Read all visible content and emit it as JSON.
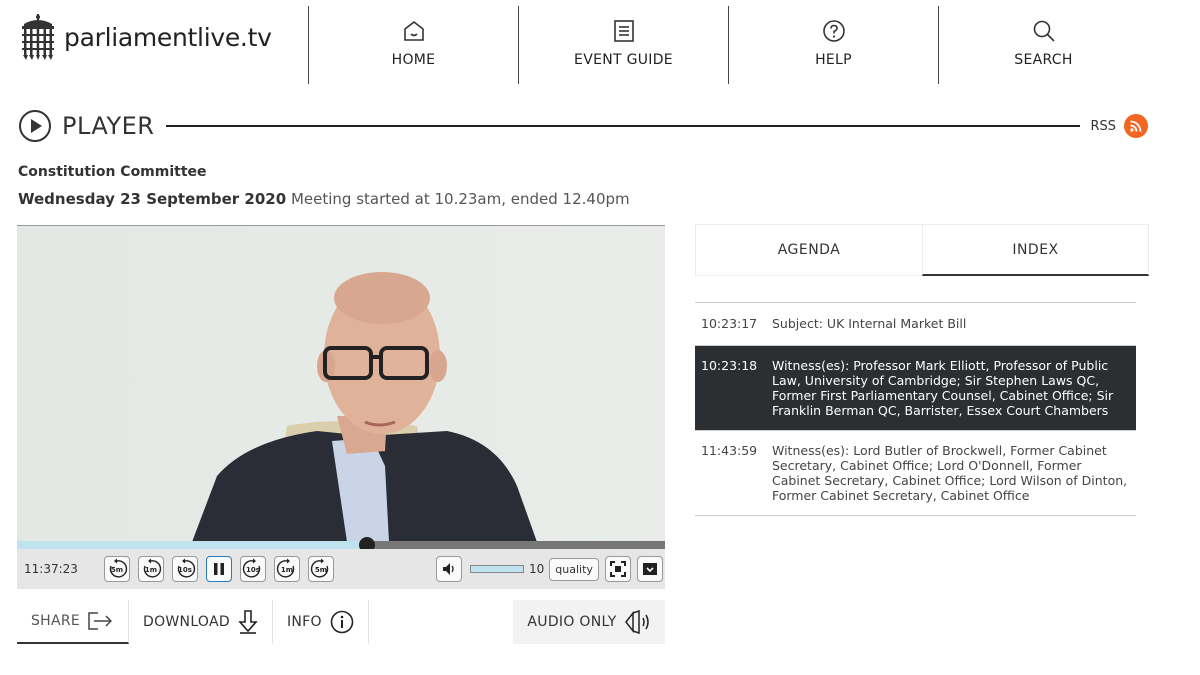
{
  "header": {
    "logo_text": "parliamentlive.tv",
    "nav": [
      {
        "label": "HOME",
        "icon": "home-icon"
      },
      {
        "label": "EVENT GUIDE",
        "icon": "event-guide-icon"
      },
      {
        "label": "HELP",
        "icon": "help-icon"
      },
      {
        "label": "SEARCH",
        "icon": "search-icon"
      }
    ]
  },
  "player": {
    "heading": "PLAYER",
    "rss_label": "RSS",
    "committee": "Constitution Committee",
    "date": "Wednesday 23 September 2020",
    "meeting_info": "Meeting started at 10.23am, ended 12.40pm"
  },
  "controls": {
    "current_time": "11:37:23",
    "progress_fraction": 0.54,
    "skip_back": [
      "5m",
      "1m",
      "10s"
    ],
    "skip_forward": [
      "10s",
      "1m",
      "5m"
    ],
    "volume_value": "10",
    "quality_label": "quality"
  },
  "actions": {
    "share": "SHARE",
    "download": "DOWNLOAD",
    "info": "INFO",
    "audio_only": "AUDIO ONLY"
  },
  "tabs": {
    "agenda": "AGENDA",
    "index": "INDEX"
  },
  "index_items": [
    {
      "time": "10:23:17",
      "text": "Subject: UK Internal Market Bill"
    },
    {
      "time": "10:23:18",
      "text": "Witness(es): Professor Mark Elliott, Professor of Public Law, University of Cambridge; Sir Stephen Laws QC, Former First Parliamentary Counsel, Cabinet Office; Sir Franklin Berman QC, Barrister, Essex Court Chambers"
    },
    {
      "time": "11:43:59",
      "text": "Witness(es): Lord Butler of Brockwell, Former Cabinet Secretary, Cabinet Office; Lord O'Donnell, Former Cabinet Secretary, Cabinet Office; Lord Wilson of Dinton, Former Cabinet Secretary, Cabinet Office"
    }
  ],
  "colors": {
    "rss": "#f26522",
    "active_row": "#2b2f31",
    "progress_fill": "#bfe3ee"
  }
}
